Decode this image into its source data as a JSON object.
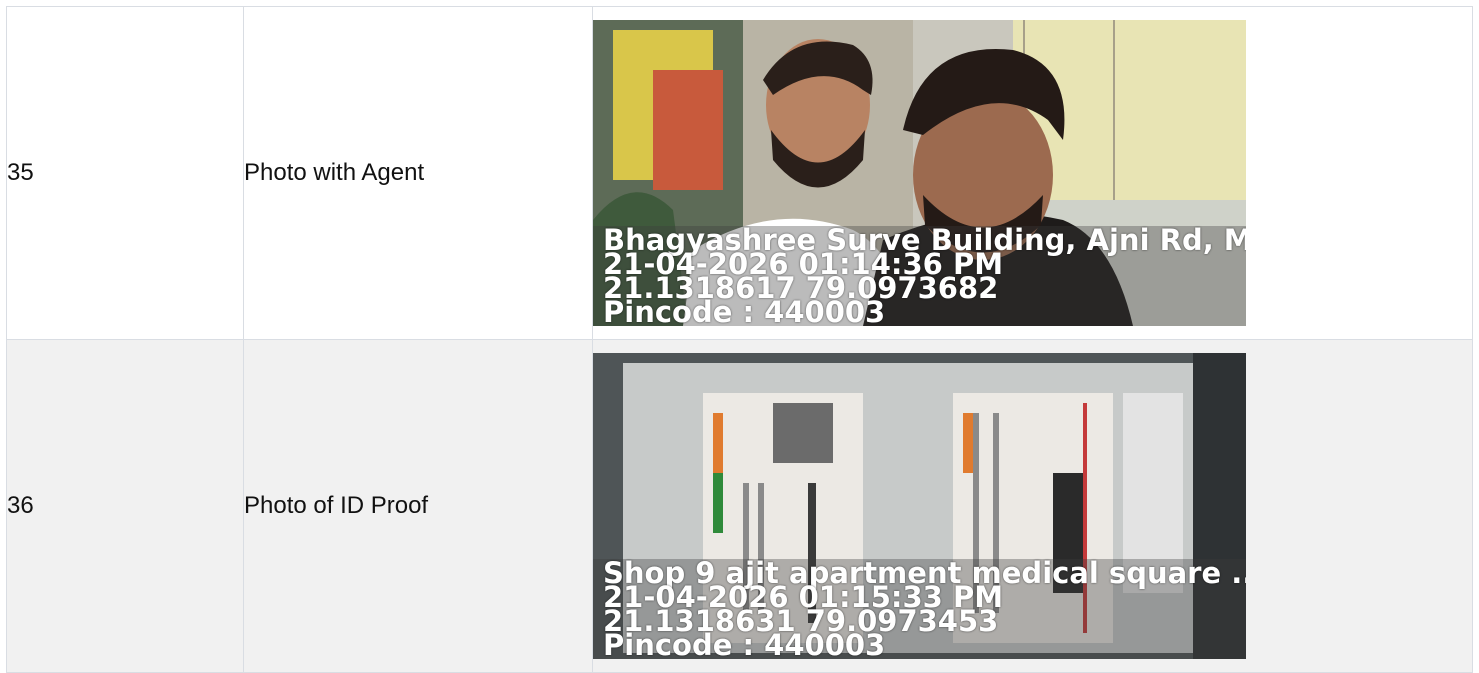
{
  "rows": [
    {
      "number": "35",
      "label": "Photo with Agent",
      "photo": {
        "subject": "selfie-with-agent",
        "stamp": {
          "address": "Bhagyashree Surve Building, Ajni Rd, Medica",
          "datetime": "21-04-2026 01:14:36 PM",
          "coords": "21.1318617 79.0973682",
          "pincode": "Pincode : 440003"
        }
      }
    },
    {
      "number": "36",
      "label": "Photo of ID Proof",
      "photo": {
        "subject": "id-card",
        "stamp": {
          "address": "Shop 9 ajit apartment medical square ...",
          "datetime": "21-04-2026 01:15:33 PM",
          "coords": "21.1318631 79.0973453",
          "pincode": "Pincode : 440003"
        }
      }
    }
  ]
}
